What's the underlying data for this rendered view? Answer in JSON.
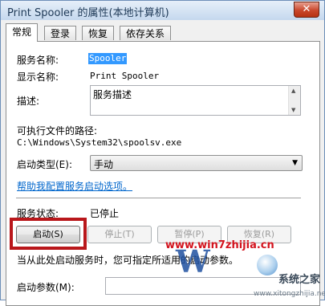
{
  "window": {
    "title": "Print Spooler 的属性(本地计算机)",
    "close_label": "✕"
  },
  "tabs": [
    "常规",
    "登录",
    "恢复",
    "依存关系"
  ],
  "general": {
    "service_name_label": "服务名称:",
    "service_name_value": "Spooler",
    "display_name_label": "显示名称:",
    "display_name_value": "Print Spooler",
    "description_label": "描述:",
    "description_value": "服务描述",
    "exe_path_label": "可执行文件的路径:",
    "exe_path_value": "C:\\Windows\\System32\\spoolsv.exe",
    "startup_type_label": "启动类型(E):",
    "startup_type_value": "手动",
    "help_link": "帮助我配置服务启动选项。",
    "status_label": "服务状态:",
    "status_value": "已停止",
    "buttons": {
      "start": "启动(S)",
      "stop": "停止(T)",
      "pause": "暂停(P)",
      "resume": "恢复(R)"
    },
    "hint_text": "当从此处启动服务时，您可指定所适用的启动参数。",
    "params_label": "启动参数(M):",
    "params_value": ""
  },
  "watermark": {
    "url": "www.win7zhijia.cn",
    "logo_letter": "W",
    "site": "系统之家",
    "site_sub": "www.xitongzhijia.net"
  },
  "colors": {
    "highlight": "#b9171b",
    "selection": "#3399ff",
    "link": "#0066cc"
  }
}
